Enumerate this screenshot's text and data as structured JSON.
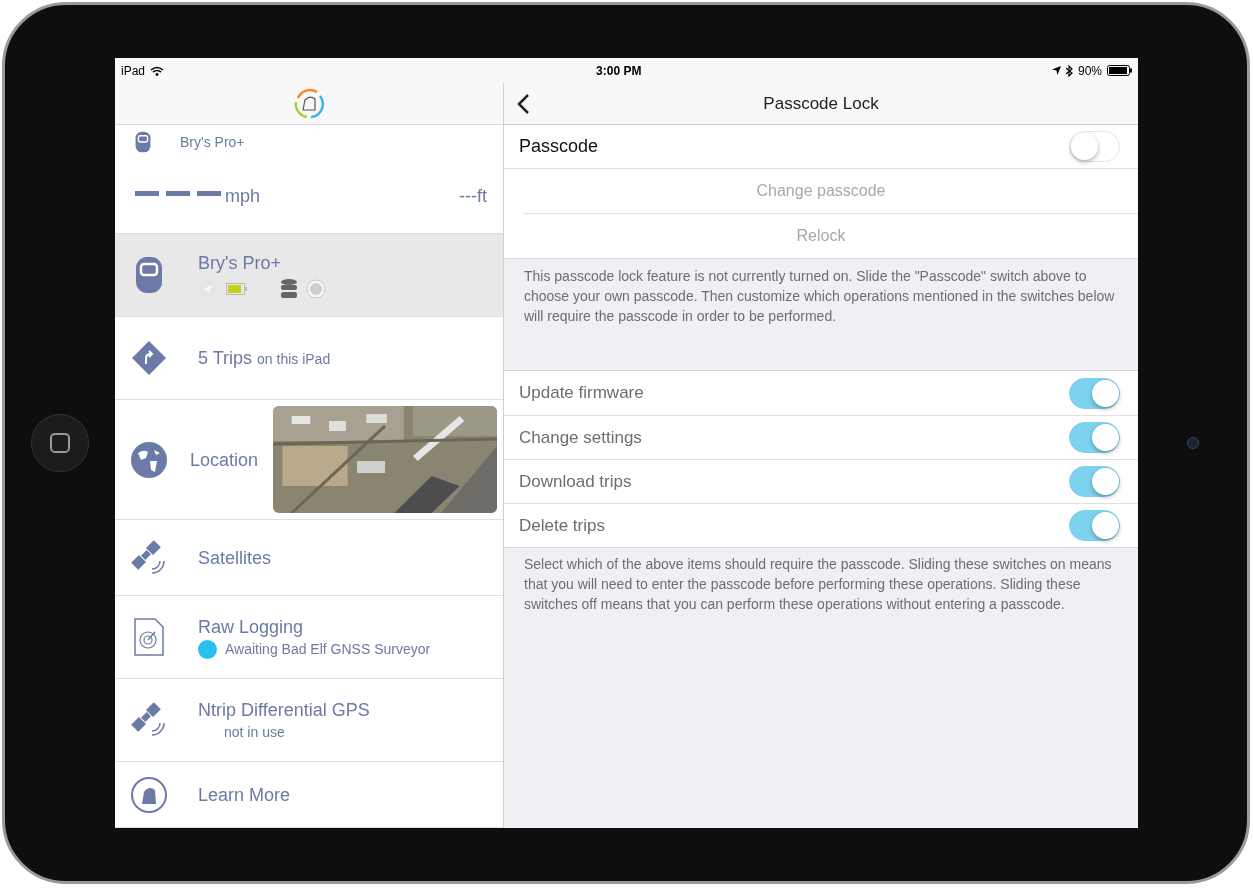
{
  "status_bar": {
    "carrier": "iPad",
    "time": "3:00 PM",
    "battery": "90%"
  },
  "sidebar": {
    "header": {
      "device_name": "Bry's Pro+",
      "speed_unit": "mph",
      "altitude": "---ft"
    },
    "items": [
      {
        "kind": "device",
        "title": "Bry's Pro+",
        "selected": true
      },
      {
        "kind": "trips",
        "title": "5 Trips",
        "detail": "on this iPad",
        "selected": false
      },
      {
        "kind": "location",
        "title": "Location",
        "selected": false
      },
      {
        "kind": "satellites",
        "title": "Satellites",
        "selected": false
      },
      {
        "kind": "logging",
        "title": "Raw Logging",
        "detail": "Awaiting Bad Elf GNSS Surveyor",
        "color": "#29c0f0",
        "selected": false
      },
      {
        "kind": "ntrip",
        "title": "Ntrip Differential GPS",
        "detail": "not in use",
        "selected": false
      },
      {
        "kind": "learn",
        "title": "Learn More",
        "selected": false
      }
    ]
  },
  "detail": {
    "title": "Passcode Lock",
    "passcode": {
      "label": "Passcode",
      "on": false
    },
    "actions": [
      {
        "label": "Change passcode",
        "disabled": true
      },
      {
        "label": "Relock",
        "disabled": true
      }
    ],
    "info": "This passcode lock feature is not currently turned on. Slide the \"Passcode\" switch above to choose your own passcode. Then customize which operations mentioned in the switches below will require the passcode in order to be performed.",
    "operations": [
      {
        "label": "Update firmware",
        "on": true
      },
      {
        "label": "Change settings",
        "on": true
      },
      {
        "label": "Download trips",
        "on": true
      },
      {
        "label": "Delete trips",
        "on": true
      }
    ],
    "footer": "Select which of the above items should require the passcode. Sliding these switches on means that you will need to enter the passcode before performing these operations. Sliding these switches off means that you can perform these operations without entering a passcode."
  }
}
